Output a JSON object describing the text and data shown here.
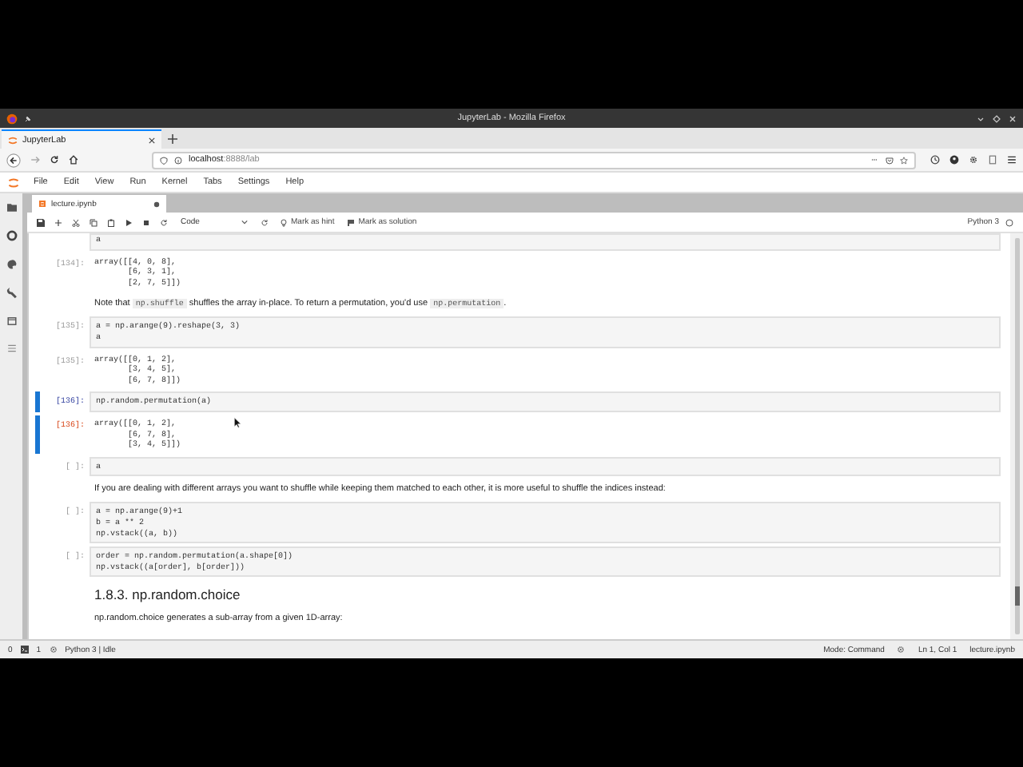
{
  "browser": {
    "window_title": "JupyterLab - Mozilla Firefox",
    "tab_title": "JupyterLab",
    "url": {
      "host": "localhost",
      "path": ":8888/lab"
    }
  },
  "menu": [
    "File",
    "Edit",
    "View",
    "Run",
    "Kernel",
    "Tabs",
    "Settings",
    "Help"
  ],
  "document_tab": {
    "title": "lecture.ipynb",
    "unsaved": true
  },
  "toolbar": {
    "cell_type": "Code",
    "buttons": [
      "Mark as hint",
      "Mark as solution"
    ],
    "kernel": "Python 3"
  },
  "cells": [
    {
      "kind": "input",
      "lines": [
        "a"
      ],
      "selected": false
    },
    {
      "kind": "output",
      "prompt": "[134]:",
      "lines": [
        "array([[4, 0, 8],",
        "       [6, 3, 1],",
        "       [2, 7, 5]])"
      ],
      "selected": false
    },
    {
      "kind": "markdown",
      "parts": [
        {
          "text": "Note that ",
          "code": false
        },
        {
          "text": "np.shuffle",
          "code": true
        },
        {
          "text": " shuffles the array in-place. To return a permutation, you'd use ",
          "code": false
        },
        {
          "text": "np.permutation",
          "code": true
        },
        {
          "text": ".",
          "code": false
        }
      ]
    },
    {
      "kind": "input",
      "prompt": "[135]:",
      "lines": [
        "a = np.arange(9).reshape(3, 3)",
        "a"
      ],
      "selected": false
    },
    {
      "kind": "output",
      "prompt": "[135]:",
      "lines": [
        "array([[0, 1, 2],",
        "       [3, 4, 5],",
        "       [6, 7, 8]])"
      ],
      "selected": false
    },
    {
      "kind": "input",
      "prompt": "[136]:",
      "lines": [
        "np.random.permutation(a)"
      ],
      "selected": true
    },
    {
      "kind": "output",
      "prompt": "[136]:",
      "lines": [
        "array([[0, 1, 2],",
        "       [6, 7, 8],",
        "       [3, 4, 5]])"
      ],
      "selected": true
    },
    {
      "kind": "input",
      "prompt": "[ ]:",
      "lines": [
        "a"
      ],
      "selected": false
    },
    {
      "kind": "markdown",
      "parts": [
        {
          "text": "If you are dealing with different arrays you want to shuffle while keeping them matched to each other, it is more useful to shuffle the indices instead:",
          "code": false
        }
      ]
    },
    {
      "kind": "input",
      "prompt": "[ ]:",
      "lines": [
        "a = np.arange(9)+1",
        "b = a ** 2",
        "np.vstack((a, b))"
      ],
      "selected": false
    },
    {
      "kind": "input",
      "prompt": "[ ]:",
      "lines": [
        "order = np.random.permutation(a.shape[0])",
        "np.vstack((a[order], b[order]))"
      ],
      "selected": false
    },
    {
      "kind": "heading",
      "text": "1.8.3. np.random.choice"
    },
    {
      "kind": "markdown",
      "parts": [
        {
          "text": "np.random.choice generates a sub-array from a given 1D-array:",
          "code": false
        }
      ]
    }
  ],
  "status_bar": {
    "terminals": "0",
    "kernels": "1",
    "kernel_status": "Python 3 | Idle",
    "mode": "Mode: Command",
    "position": "Ln 1, Col 1",
    "file": "lecture.ipynb"
  }
}
